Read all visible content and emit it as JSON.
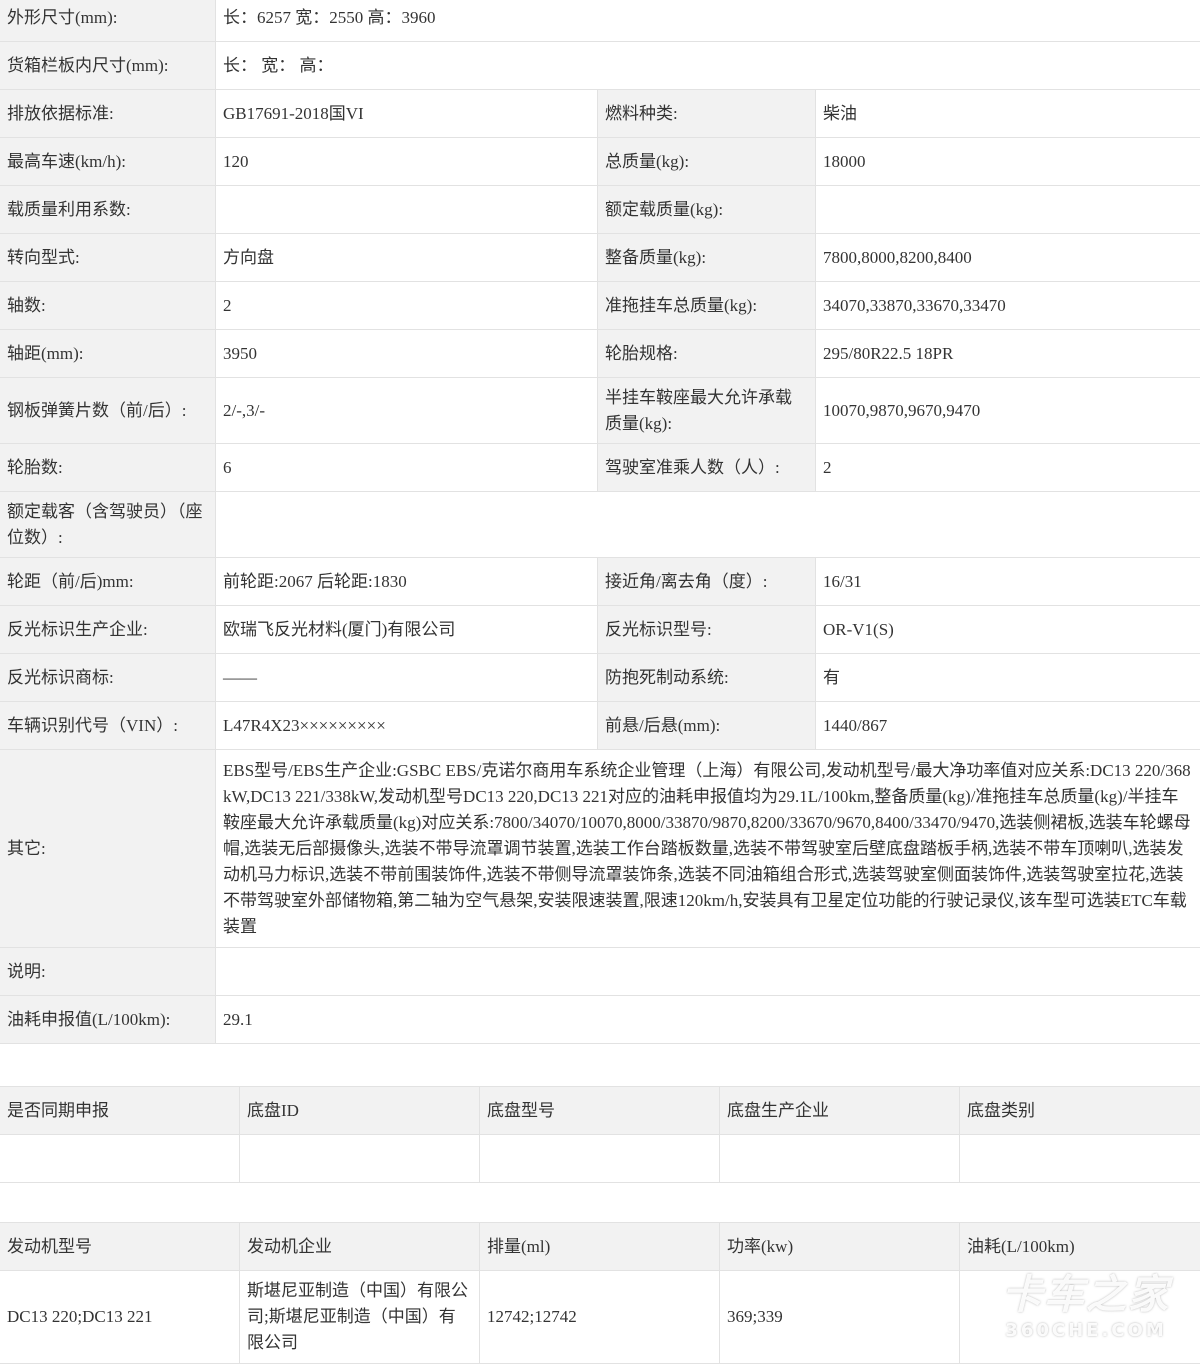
{
  "spec": {
    "dims_label": "外形尺寸(mm):",
    "dims_value": "长：6257 宽：2550 高：3960",
    "cargo_label": "货箱栏板内尺寸(mm):",
    "cargo_value": "长： 宽： 高：",
    "emission_label": "排放依据标准:",
    "emission_value": "GB17691-2018国VI",
    "fuel_label": "燃料种类:",
    "fuel_value": "柴油",
    "speed_label": "最高车速(km/h):",
    "speed_value": "120",
    "total_mass_label": "总质量(kg):",
    "total_mass_value": "18000",
    "util_label": "载质量利用系数:",
    "util_value": "",
    "rated_load_label": "额定载质量(kg):",
    "rated_load_value": "",
    "steering_label": "转向型式:",
    "steering_value": "方向盘",
    "curb_label": "整备质量(kg):",
    "curb_value": "7800,8000,8200,8400",
    "axles_label": "轴数:",
    "axles_value": "2",
    "trailer_label": "准拖挂车总质量(kg):",
    "trailer_value": "34070,33870,33670,33470",
    "wheelbase_label": "轴距(mm):",
    "wheelbase_value": "3950",
    "tire_label": "轮胎规格:",
    "tire_value": "295/80R22.5 18PR",
    "spring_label": "钢板弹簧片数（前/后）:",
    "spring_value": "2/-,3/-",
    "saddle_label": "半挂车鞍座最大允许承载质量(kg):",
    "saddle_value": "10070,9870,9670,9470",
    "tires_label": "轮胎数:",
    "tires_value": "6",
    "cab_label": "驾驶室准乘人数（人）:",
    "cab_value": "2",
    "pass_label": "额定载客（含驾驶员）（座位数）:",
    "pass_value": "",
    "track_label": "轮距（前/后)mm:",
    "track_value": "前轮距:2067 后轮距:1830",
    "angle_label": "接近角/离去角（度）:",
    "angle_value": "16/31",
    "refl_mfr_label": "反光标识生产企业:",
    "refl_mfr_value": "欧瑞飞反光材料(厦门)有限公司",
    "refl_model_label": "反光标识型号:",
    "refl_model_value": "OR-V1(S)",
    "refl_brand_label": "反光标识商标:",
    "refl_brand_value": "——",
    "abs_label": "防抱死制动系统:",
    "abs_value": "有",
    "vin_label": "车辆识别代号（VIN）:",
    "vin_value": "L47R4X23×××××××××",
    "overhang_label": "前悬/后悬(mm):",
    "overhang_value": "1440/867",
    "other_label": "其它:",
    "other_value": "EBS型号/EBS生产企业:GSBC EBS/克诺尔商用车系统企业管理（上海）有限公司,发动机型号/最大净功率值对应关系:DC13 220/368kW,DC13 221/338kW,发动机型号DC13 220,DC13 221对应的油耗申报值均为29.1L/100km,整备质量(kg)/准拖挂车总质量(kg)/半挂车鞍座最大允许承载质量(kg)对应关系:7800/34070/10070,8000/33870/9870,8200/33670/9670,8400/33470/9470,选装侧裙板,选装车轮螺母帽,选装无后部摄像头,选装不带导流罩调节装置,选装工作台踏板数量,选装不带驾驶室后壁底盘踏板手柄,选装不带车顶喇叭,选装发动机马力标识,选装不带前围装饰件,选装不带侧导流罩装饰条,选装不同油箱组合形式,选装驾驶室侧面装饰件,选装驾驶室拉花,选装不带驾驶室外部储物箱,第二轴为空气悬架,安装限速装置,限速120km/h,安装具有卫星定位功能的行驶记录仪,该车型可选装ETC车载装置",
    "note_label": "说明:",
    "note_value": "",
    "fuelcons_label": "油耗申报值(L/100km):",
    "fuelcons_value": "29.1"
  },
  "chassis": {
    "headers": [
      "是否同期申报",
      "底盘ID",
      "底盘型号",
      "底盘生产企业",
      "底盘类别"
    ],
    "row": [
      "",
      "",
      "",
      "",
      ""
    ]
  },
  "engine": {
    "headers": [
      "发动机型号",
      "发动机企业",
      "排量(ml)",
      "功率(kw)",
      "油耗(L/100km)"
    ],
    "row": [
      "DC13 220;DC13 221",
      "斯堪尼亚制造（中国）有限公司;斯堪尼亚制造（中国）有限公司",
      "12742;12742",
      "369;339",
      ""
    ]
  },
  "watermark": {
    "main": "卡车之家",
    "sub": "360CHE.COM"
  }
}
